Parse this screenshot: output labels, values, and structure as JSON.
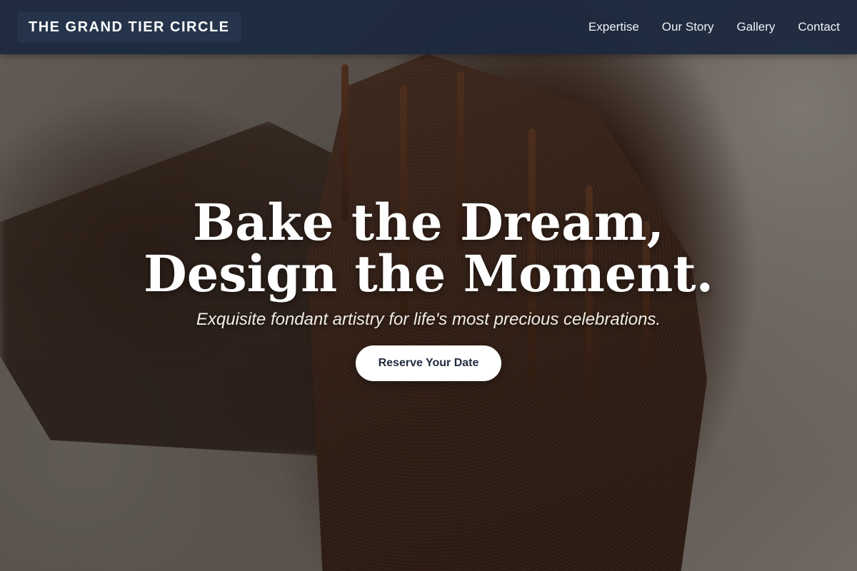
{
  "header": {
    "logo": "THE GRAND TIER CIRCLE",
    "nav": [
      {
        "label": "Expertise"
      },
      {
        "label": "Our Story"
      },
      {
        "label": "Gallery"
      },
      {
        "label": "Contact"
      }
    ]
  },
  "hero": {
    "headline_line1": "Bake the Dream,",
    "headline_line2": "Design the Moment.",
    "tagline": "Exquisite fondant artistry for life's most precious celebrations.",
    "cta_label": "Reserve Your Date",
    "background_image": "chocolate cake slice with drizzled chocolate"
  },
  "colors": {
    "header_bg": "#1c283e",
    "cta_bg": "#ffffff",
    "cta_text": "#1f2a3d",
    "headline": "#ffffff"
  }
}
